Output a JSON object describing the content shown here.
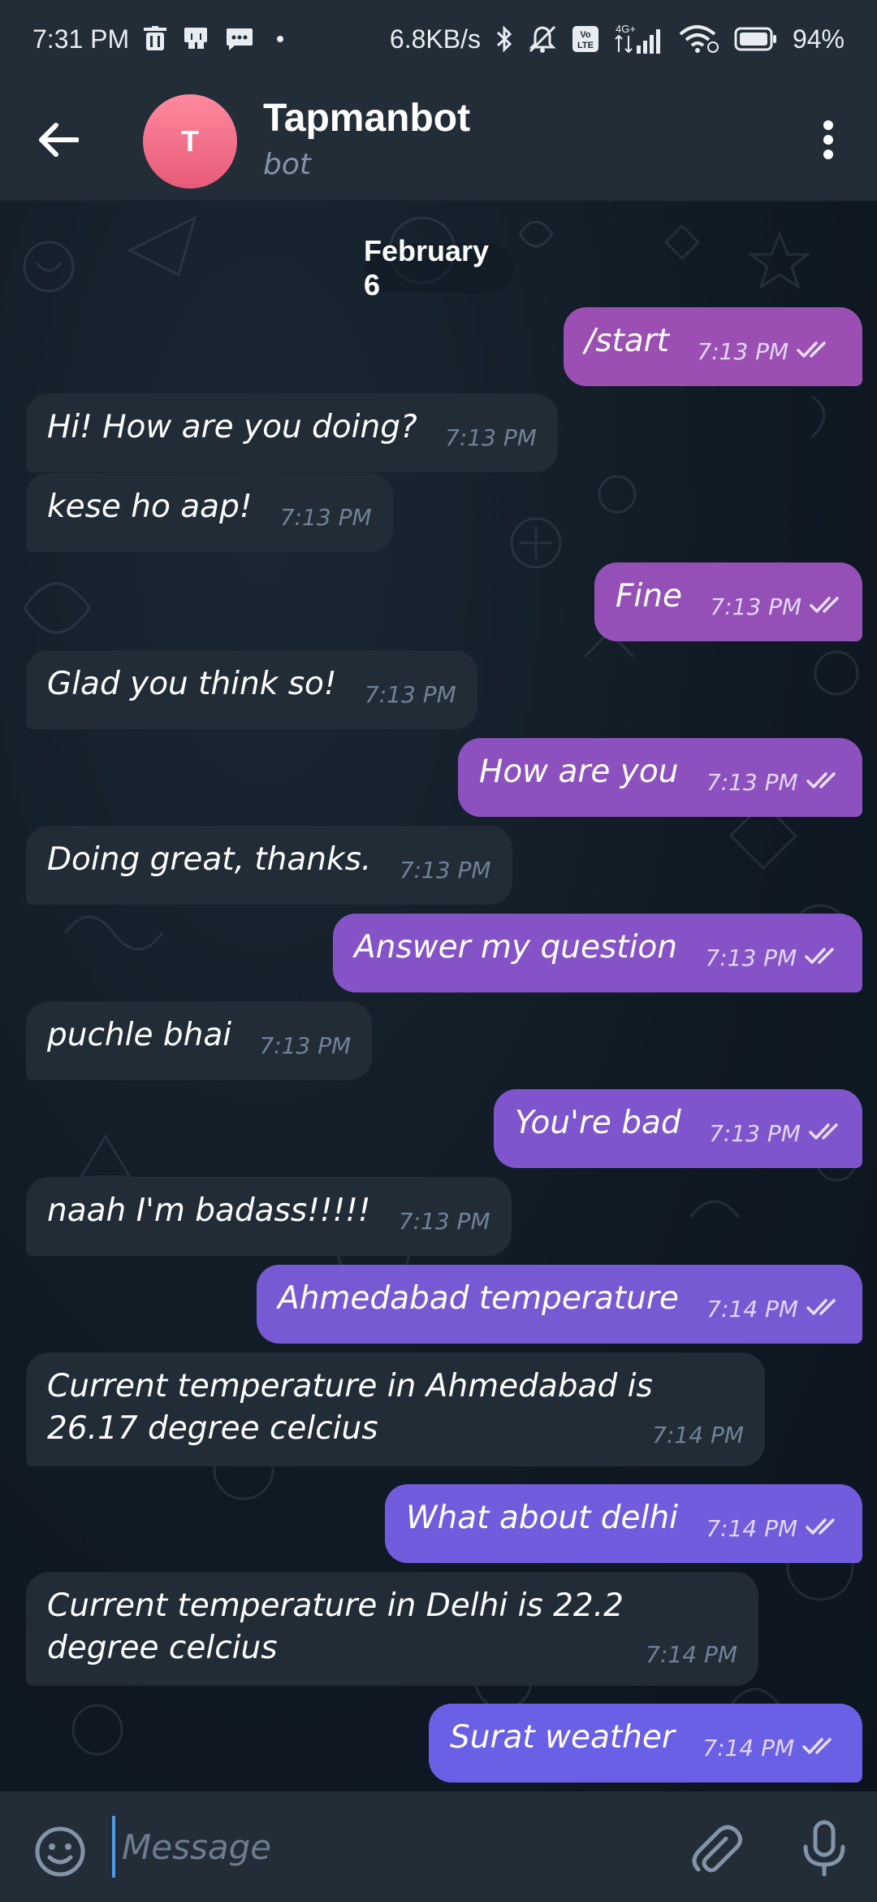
{
  "status_bar": {
    "time": "7:31 PM",
    "network_speed": "6.8KB/s",
    "network_type": "4G+",
    "volte": "Vo LTE",
    "battery": "94%"
  },
  "header": {
    "back_icon": "arrow-left-icon",
    "avatar_letter": "T",
    "avatar_color": "#e8607c",
    "title": "Tapmanbot",
    "subtitle": "bot",
    "menu_icon": "more-vertical-icon"
  },
  "chat": {
    "date_separator": "February 6",
    "messages": [
      {
        "dir": "out",
        "text": "/start",
        "time": "7:13 PM",
        "read": true
      },
      {
        "dir": "in",
        "text": "Hi! How are you doing?",
        "time": "7:13 PM"
      },
      {
        "dir": "in",
        "text": "kese ho aap!",
        "time": "7:13 PM"
      },
      {
        "dir": "out",
        "text": "Fine",
        "time": "7:13 PM",
        "read": true
      },
      {
        "dir": "in",
        "text": "Glad you think so!",
        "time": "7:13 PM"
      },
      {
        "dir": "out",
        "text": "How are you",
        "time": "7:13 PM",
        "read": true
      },
      {
        "dir": "in",
        "text": "Doing great, thanks.",
        "time": "7:13 PM"
      },
      {
        "dir": "out",
        "text": "Answer my question",
        "time": "7:13 PM",
        "read": true
      },
      {
        "dir": "in",
        "text": "puchle bhai",
        "time": "7:13 PM"
      },
      {
        "dir": "out",
        "text": "You're bad",
        "time": "7:13 PM",
        "read": true
      },
      {
        "dir": "in",
        "text": "naah I'm badass!!!!!",
        "time": "7:13 PM"
      },
      {
        "dir": "out",
        "text": "Ahmedabad temperature",
        "time": "7:14 PM",
        "read": true
      },
      {
        "dir": "in",
        "text": "Current temperature in Ahmedabad is 26.17 degree celcius",
        "time": "7:14 PM"
      },
      {
        "dir": "out",
        "text": "What about delhi",
        "time": "7:14 PM",
        "read": true
      },
      {
        "dir": "in",
        "text": "Current temperature in Delhi is 22.2 degree celcius",
        "time": "7:14 PM"
      },
      {
        "dir": "out",
        "text": "Surat weather",
        "time": "7:14 PM",
        "read": true
      }
    ]
  },
  "input_bar": {
    "emoji_icon": "smile-icon",
    "placeholder": "Message",
    "attach_icon": "paperclip-icon",
    "mic_icon": "microphone-icon"
  },
  "colors": {
    "header_bg": "#222d38",
    "incoming_bubble": "#212c37",
    "outgoing_top": "#9b4fb3",
    "outgoing_bottom": "#6a6cf0",
    "chat_bg": "#0f1923"
  }
}
